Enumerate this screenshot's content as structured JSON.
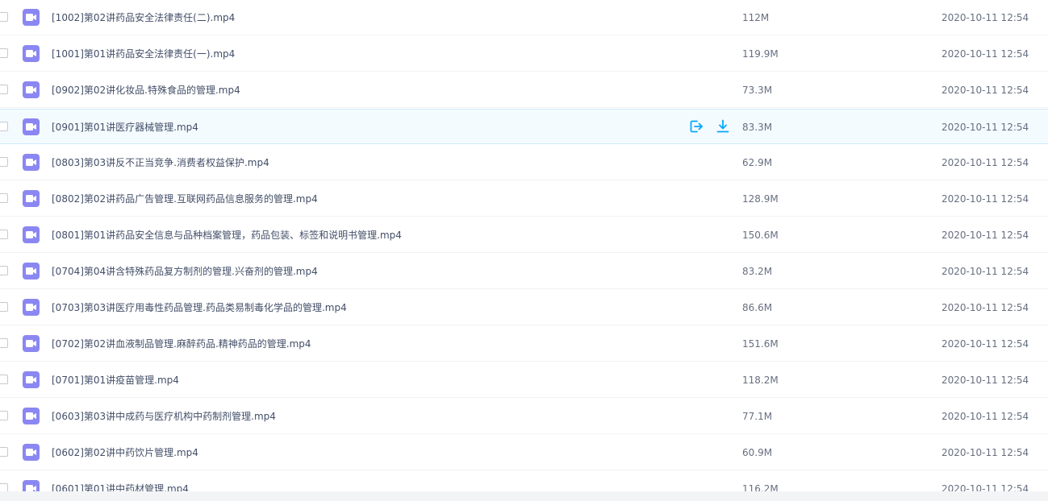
{
  "icons": {
    "file_type": "video-file-icon",
    "share": "share-icon",
    "download": "download-icon"
  },
  "colors": {
    "video_icon": "#8b87f2",
    "action_icon": "#06a7ff",
    "hover_row": "#f4fbff"
  },
  "files": [
    {
      "name": "[1002]第02讲药品安全法律责任(二).mp4",
      "size": "112M",
      "date": "2020-10-11 12:54"
    },
    {
      "name": "[1001]第01讲药品安全法律责任(一).mp4",
      "size": "119.9M",
      "date": "2020-10-11 12:54"
    },
    {
      "name": "[0902]第02讲化妆品.特殊食品的管理.mp4",
      "size": "73.3M",
      "date": "2020-10-11 12:54"
    },
    {
      "name": "[0901]第01讲医疗器械管理.mp4",
      "size": "83.3M",
      "date": "2020-10-11 12:54",
      "hovered": true
    },
    {
      "name": "[0803]第03讲反不正当竞争.消费者权益保护.mp4",
      "size": "62.9M",
      "date": "2020-10-11 12:54"
    },
    {
      "name": "[0802]第02讲药品广告管理.互联网药品信息服务的管理.mp4",
      "size": "128.9M",
      "date": "2020-10-11 12:54"
    },
    {
      "name": "[0801]第01讲药品安全信息与品种档案管理，药品包装、标签和说明书管理.mp4",
      "size": "150.6M",
      "date": "2020-10-11 12:54"
    },
    {
      "name": "[0704]第04讲含特殊药品复方制剂的管理.兴奋剂的管理.mp4",
      "size": "83.2M",
      "date": "2020-10-11 12:54"
    },
    {
      "name": "[0703]第03讲医疗用毒性药品管理.药品类易制毒化学品的管理.mp4",
      "size": "86.6M",
      "date": "2020-10-11 12:54"
    },
    {
      "name": "[0702]第02讲血液制品管理.麻醉药品.精神药品的管理.mp4",
      "size": "151.6M",
      "date": "2020-10-11 12:54"
    },
    {
      "name": "[0701]第01讲疫苗管理.mp4",
      "size": "118.2M",
      "date": "2020-10-11 12:54"
    },
    {
      "name": "[0603]第03讲中成药与医疗机构中药制剂管理.mp4",
      "size": "77.1M",
      "date": "2020-10-11 12:54"
    },
    {
      "name": "[0602]第02讲中药饮片管理.mp4",
      "size": "60.9M",
      "date": "2020-10-11 12:54"
    },
    {
      "name": "[0601]第01讲中药材管理.mp4",
      "size": "116.2M",
      "date": "2020-10-11 12:54"
    }
  ]
}
